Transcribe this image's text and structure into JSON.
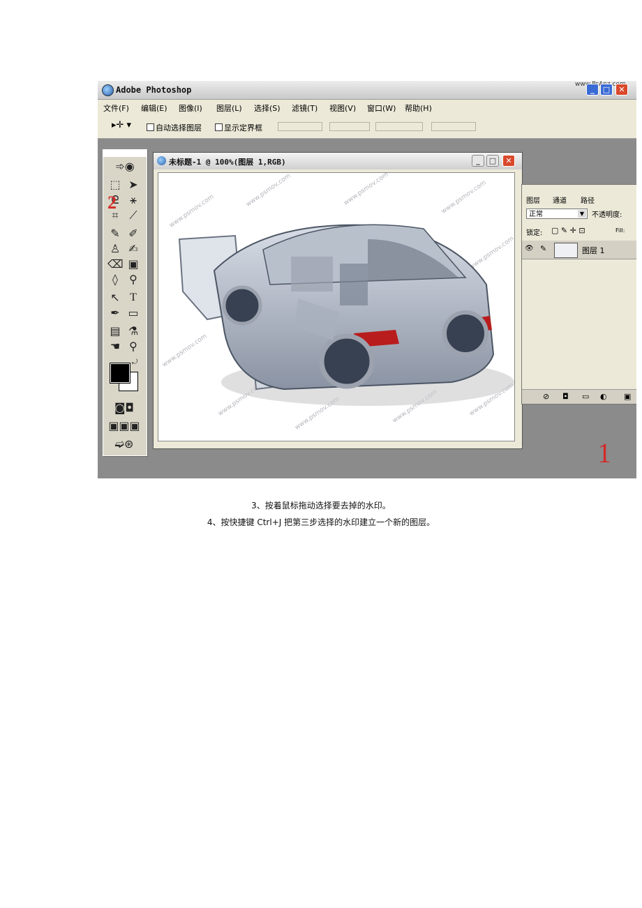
{
  "window": {
    "title": "Adobe Photoshop",
    "watermark": "www.PsAnz.com"
  },
  "menus": [
    "文件(F)",
    "编辑(E)",
    "图像(I)",
    "图层(L)",
    "选择(S)",
    "滤镜(T)",
    "视图(V)",
    "窗口(W)",
    "帮助(H)"
  ],
  "options": {
    "auto_select": "自动选择图层",
    "show_bbox": "显示定界框"
  },
  "document": {
    "title": "未标题-1 @ 100%(图层 1,RGB)",
    "watermark_text": "www.psmov.com"
  },
  "layers_panel": {
    "tabs": [
      "图层",
      "通道",
      "路径"
    ],
    "blend_mode": "正常",
    "opacity_label": "不透明度:",
    "lock_label": "锁定:",
    "fill_label": "Fill:",
    "layer_name": "图层 1"
  },
  "annotations": {
    "marker_1": "1",
    "marker_2": "2"
  },
  "captions": {
    "step3": "3、按着鼠标拖动选择要去掉的水印。",
    "step4": "4、按快捷键 Ctrl+J  把第三步选择的水印建立一个新的图层。"
  },
  "colors": {
    "workspace": "#8b8b8b",
    "close_button": "#d9482b",
    "marker": "#d42a2a"
  }
}
